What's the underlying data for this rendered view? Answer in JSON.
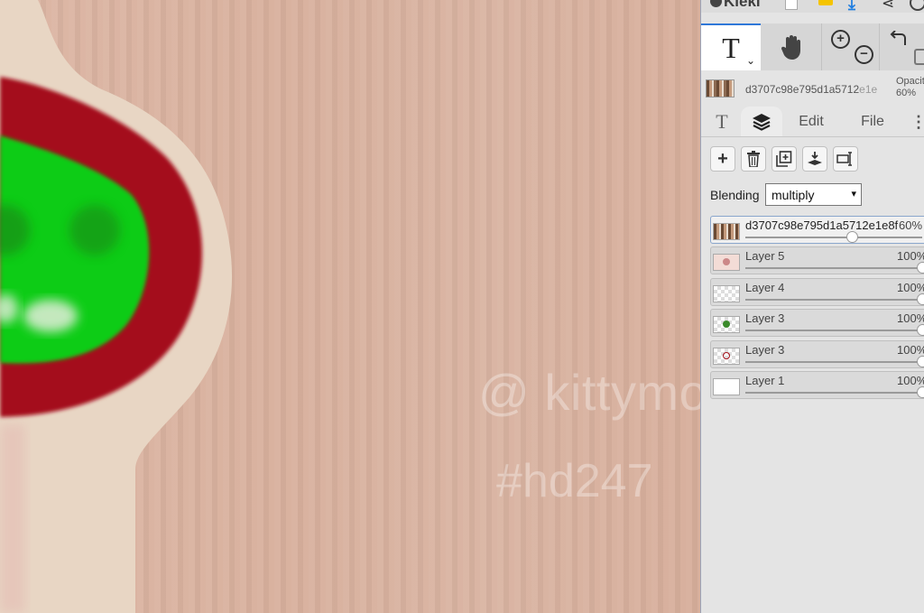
{
  "canvas": {
    "watermark_handle": "@ kittymo",
    "watermark_tag": "#hd247"
  },
  "app": {
    "brand": "Kleki"
  },
  "tools": {
    "text_glyph": "T",
    "caret": "⌄",
    "icons": [
      "text-tool-icon",
      "hand-tool-icon",
      "zoom-in-icon",
      "zoom-out-icon",
      "undo-icon",
      "redo-icon"
    ]
  },
  "current_layer": {
    "name": "d3707c98e795d1a5712e1e8f",
    "name_visible": "d3707c98e795d1a5712",
    "name_faded": "e1e",
    "opacity_label": "Opacity",
    "opacity_value": "60%"
  },
  "tabs": {
    "text": "T",
    "edit": "Edit",
    "file": "File",
    "more": "⋮"
  },
  "layer_buttons": [
    "add-layer",
    "delete-layer",
    "duplicate-layer",
    "merge-layer",
    "rename-layer"
  ],
  "blending": {
    "label": "Blending",
    "value": "multiply",
    "arrow": "▾"
  },
  "layers": [
    {
      "name": "d3707c98e795d1a5712e1e8f",
      "opacity": "60%",
      "level": 0.6,
      "active": true,
      "thumb": "photo"
    },
    {
      "name": "Layer 5",
      "opacity": "100%",
      "level": 1.0,
      "active": false,
      "thumb": "pinkish"
    },
    {
      "name": "Layer 4",
      "opacity": "100%",
      "level": 1.0,
      "active": false,
      "thumb": "transparent"
    },
    {
      "name": "Layer 3",
      "opacity": "100%",
      "level": 1.0,
      "active": false,
      "thumb": "transparent-green"
    },
    {
      "name": "Layer 3",
      "opacity": "100%",
      "level": 1.0,
      "active": false,
      "thumb": "transparent-red"
    },
    {
      "name": "Layer 1",
      "opacity": "100%",
      "level": 1.0,
      "active": false,
      "thumb": "white"
    }
  ],
  "colors": {
    "accent": "#2f78d8",
    "canvas_bg": "#d9b4a2",
    "shape_red": "#a10f17",
    "shape_green": "#0ccc12",
    "shape_cream": "#e8d8c6"
  }
}
